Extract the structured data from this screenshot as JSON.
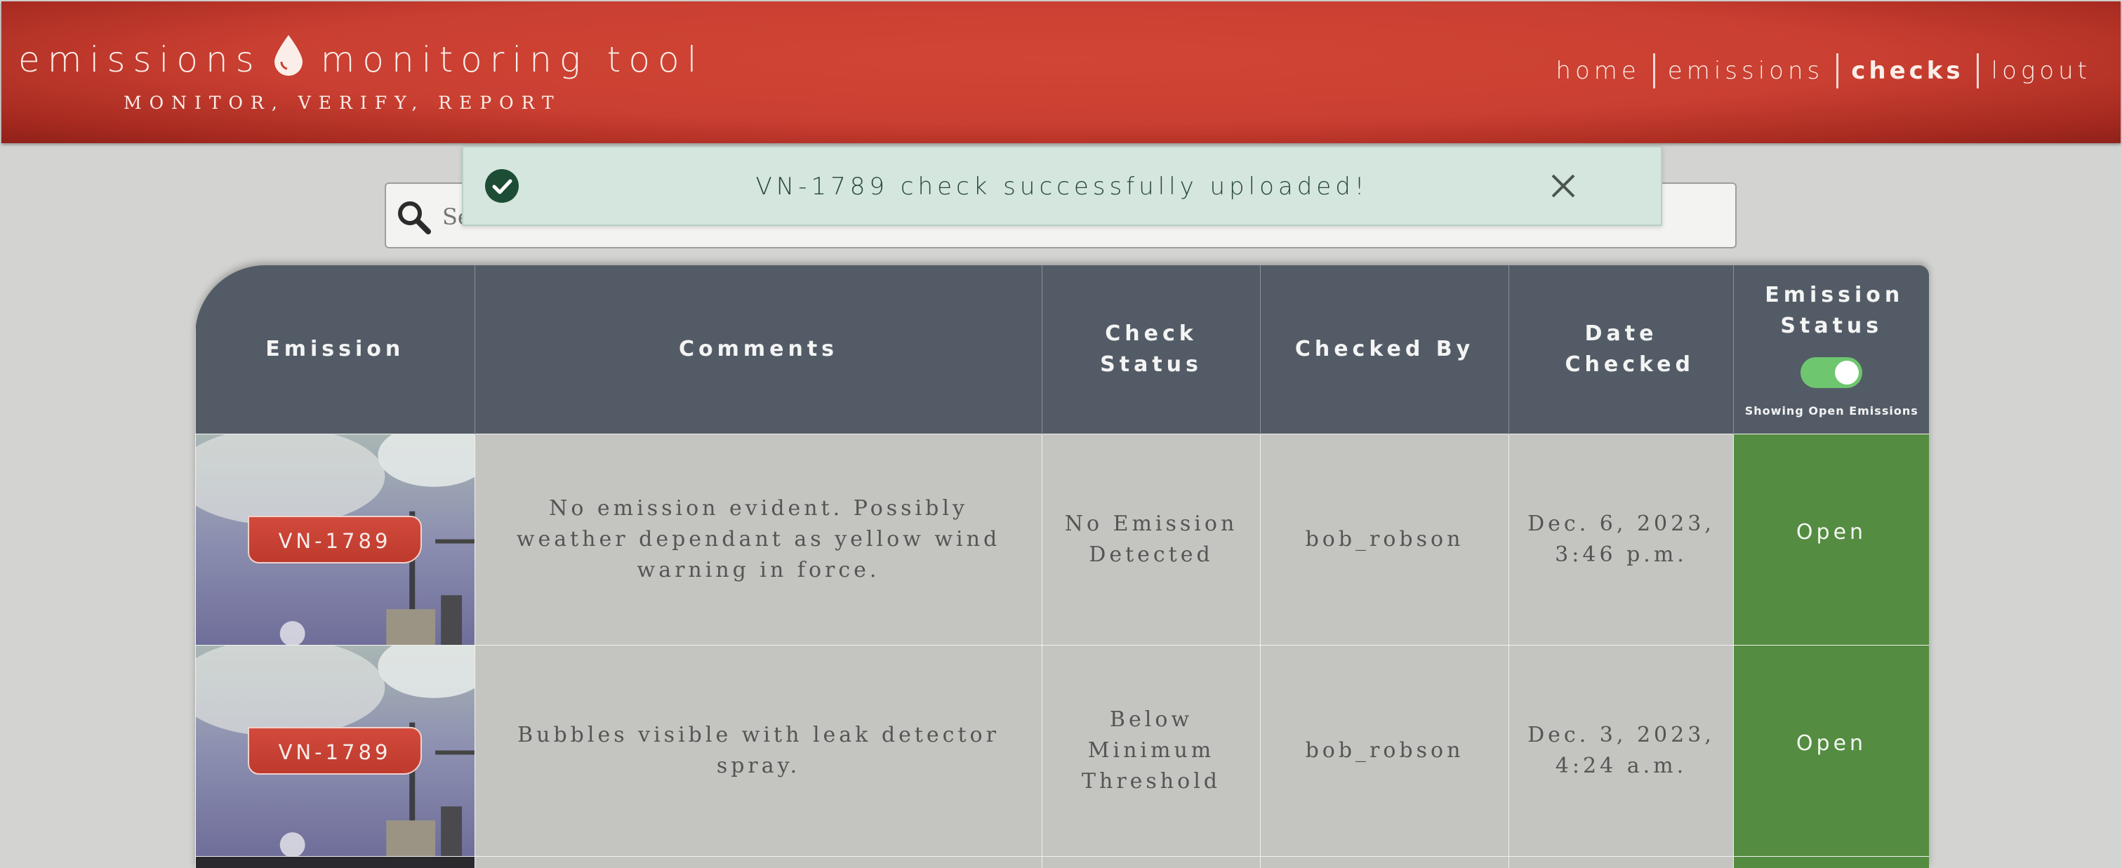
{
  "app": {
    "title": "emissions monitoring tool",
    "title_left": "emissions",
    "title_right": "monitoring tool",
    "tagline": "MONITOR, VERIFY, REPORT",
    "logo_icon": "drop-icon"
  },
  "nav": {
    "items": [
      "home",
      "emissions",
      "checks",
      "logout"
    ],
    "active": "checks"
  },
  "search": {
    "placeholder": "Search...",
    "icon": "search-icon"
  },
  "alert": {
    "message": "VN-1789 check successfully uploaded!",
    "icon": "check-circle-icon",
    "close_icon": "close-icon"
  },
  "table": {
    "headers": {
      "emission": "Emission",
      "comments": "Comments",
      "check_status": "Check Status",
      "checked_by": "Checked By",
      "date_checked": "Date Checked",
      "emission_status": "Emission Status"
    },
    "toggle": {
      "caption": "Showing Open Emissions",
      "on": true
    },
    "rows": [
      {
        "emission": "VN-1789",
        "comments": "No emission evident. Possibly weather dependant as yellow wind warning in force.",
        "check_status": "No Emission Detected",
        "checked_by": "bob_robson",
        "date_checked": "Dec. 6, 2023, 3:46 p.m.",
        "emission_status": "Open"
      },
      {
        "emission": "VN-1789",
        "comments": "Bubbles visible with leak detector spray.",
        "check_status": "Below Minimum Threshold",
        "checked_by": "bob_robson",
        "date_checked": "Dec. 3, 2023, 4:24 a.m.",
        "emission_status": "Open"
      }
    ]
  },
  "colors": {
    "header": "#c93f31",
    "table_header": "#535c66",
    "cell": "#c6c7c3",
    "status_open": "#548c41",
    "alert_bg": "#d4e6dd",
    "tag": "#c94234"
  }
}
